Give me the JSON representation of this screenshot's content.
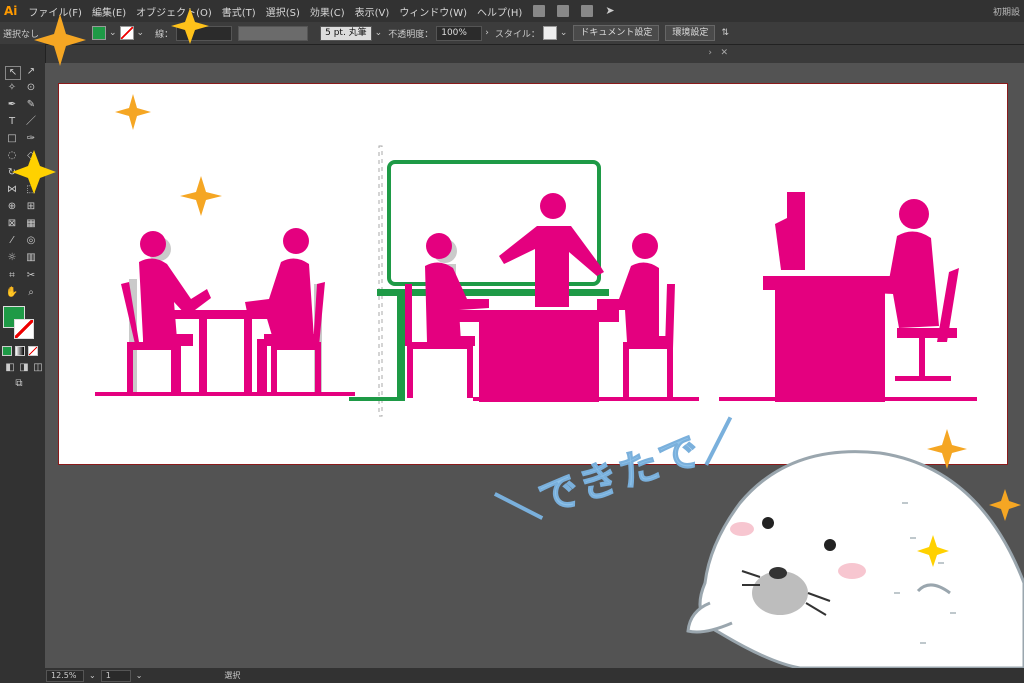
{
  "app": {
    "logo": "Ai"
  },
  "menu": [
    "ファイル(F)",
    "編集(E)",
    "オブジェクト(O)",
    "書式(T)",
    "選択(S)",
    "効果(C)",
    "表示(V)",
    "ウィンドウ(W)",
    "ヘルプ(H)"
  ],
  "menu_right": "初期設",
  "control": {
    "selection": "選択なし",
    "stroke_label": "線：",
    "brush": "5 pt. 丸筆",
    "opacity_label": "不透明度：",
    "opacity_value": "100%",
    "style_label": "スタイル：",
    "document_setup": "ドキュメント設定",
    "preferences": "環境設定"
  },
  "colors": {
    "fill": "#1e9a46",
    "magenta": "#e4007f",
    "green": "#1e9a46",
    "sparkle": "#f5a623",
    "caption": "#8ec1e8"
  },
  "status": {
    "zoom": "12.5%",
    "artboard": "1",
    "tool": "選択"
  },
  "caption": "＼できたで／"
}
